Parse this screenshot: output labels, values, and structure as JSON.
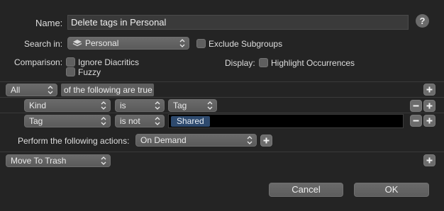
{
  "header": {
    "name_label": "Name:",
    "name_value": "Delete tags in Personal",
    "help_glyph": "?",
    "help_icon": "help-question-icon"
  },
  "search": {
    "label": "Search in:",
    "location": "Personal",
    "location_icon": "stack-layers-icon",
    "exclude_label": "Exclude Subgroups",
    "exclude_checked": false
  },
  "options": {
    "comparison_label": "Comparison:",
    "ignore_diacritics": "Ignore Diacritics",
    "fuzzy": "Fuzzy",
    "display_label": "Display:",
    "highlight": "Highlight Occurrences"
  },
  "criteria": {
    "match": "All",
    "match_suffix": "of the following are true",
    "rows": [
      {
        "field": "Kind",
        "operator": "is",
        "value": "Tag"
      },
      {
        "field": "Tag",
        "operator": "is not",
        "token": "Shared"
      }
    ]
  },
  "actions": {
    "label": "Perform the following actions:",
    "trigger": "On Demand",
    "action": "Move To Trash"
  },
  "buttons": {
    "plus": "+",
    "minus": "−",
    "cancel": "Cancel",
    "ok": "OK"
  },
  "colors": {
    "background": "#242424",
    "control": "#616161",
    "token": "#2e4a6e"
  }
}
